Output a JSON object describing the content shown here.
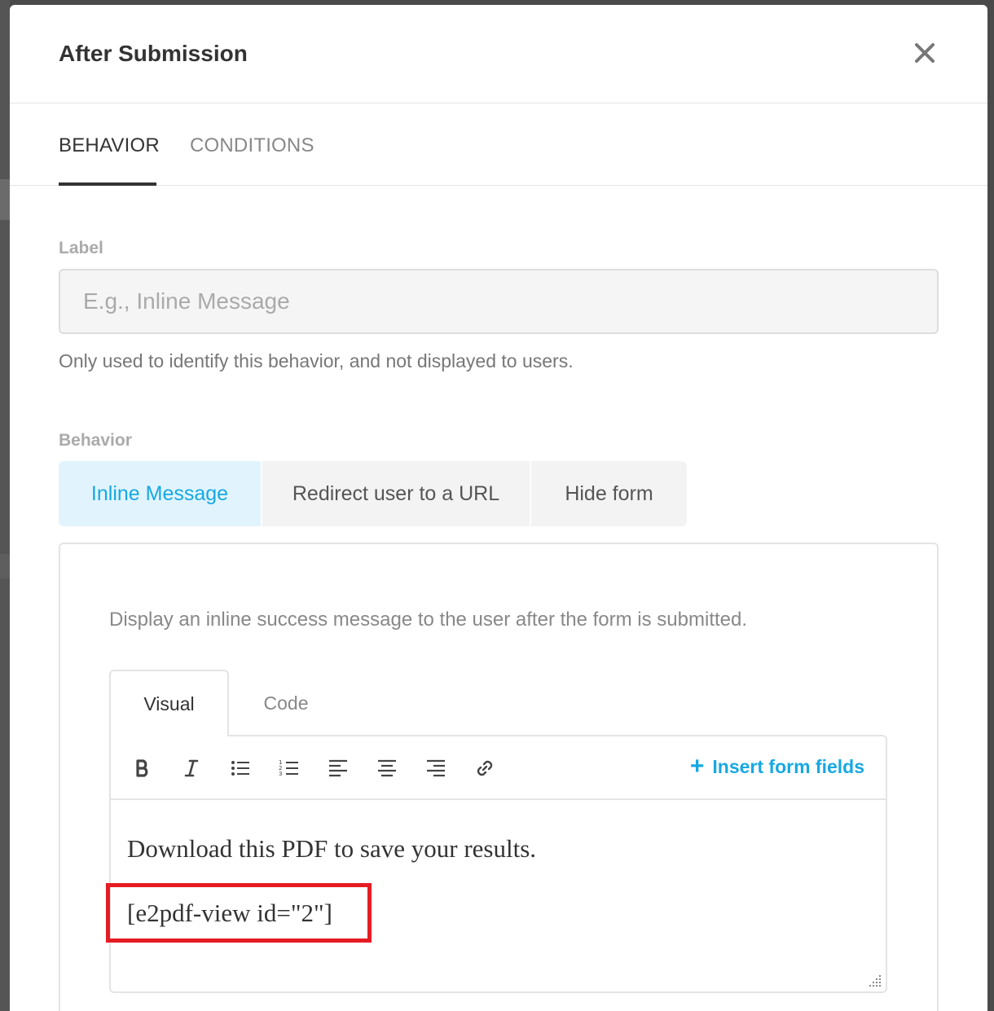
{
  "modal": {
    "title": "After Submission"
  },
  "tabs": [
    {
      "label": "BEHAVIOR",
      "active": true
    },
    {
      "label": "CONDITIONS",
      "active": false
    }
  ],
  "label_field": {
    "label": "Label",
    "placeholder": "E.g., Inline Message",
    "value": "",
    "help": "Only used to identify this behavior, and not displayed to users."
  },
  "behavior": {
    "label": "Behavior",
    "options": [
      {
        "label": "Inline Message",
        "selected": true
      },
      {
        "label": "Redirect user to a URL",
        "selected": false
      },
      {
        "label": "Hide form",
        "selected": false
      }
    ],
    "description": "Display an inline success message to the user after the form is submitted."
  },
  "editor": {
    "tabs": [
      {
        "label": "Visual",
        "active": true
      },
      {
        "label": "Code",
        "active": false
      }
    ],
    "toolbar": {
      "icons": [
        "bold-icon",
        "italic-icon",
        "bullet-list-icon",
        "numbered-list-icon",
        "align-left-icon",
        "align-center-icon",
        "align-right-icon",
        "link-icon"
      ],
      "insert_label": "Insert form fields"
    },
    "content": {
      "line1": "Download this PDF to save your results.",
      "line2": "[e2pdf-view id=\"2\"]"
    }
  },
  "colors": {
    "accent": "#17a8e3",
    "selected_bg": "#e1f4fd",
    "highlight": "#e51c23"
  }
}
